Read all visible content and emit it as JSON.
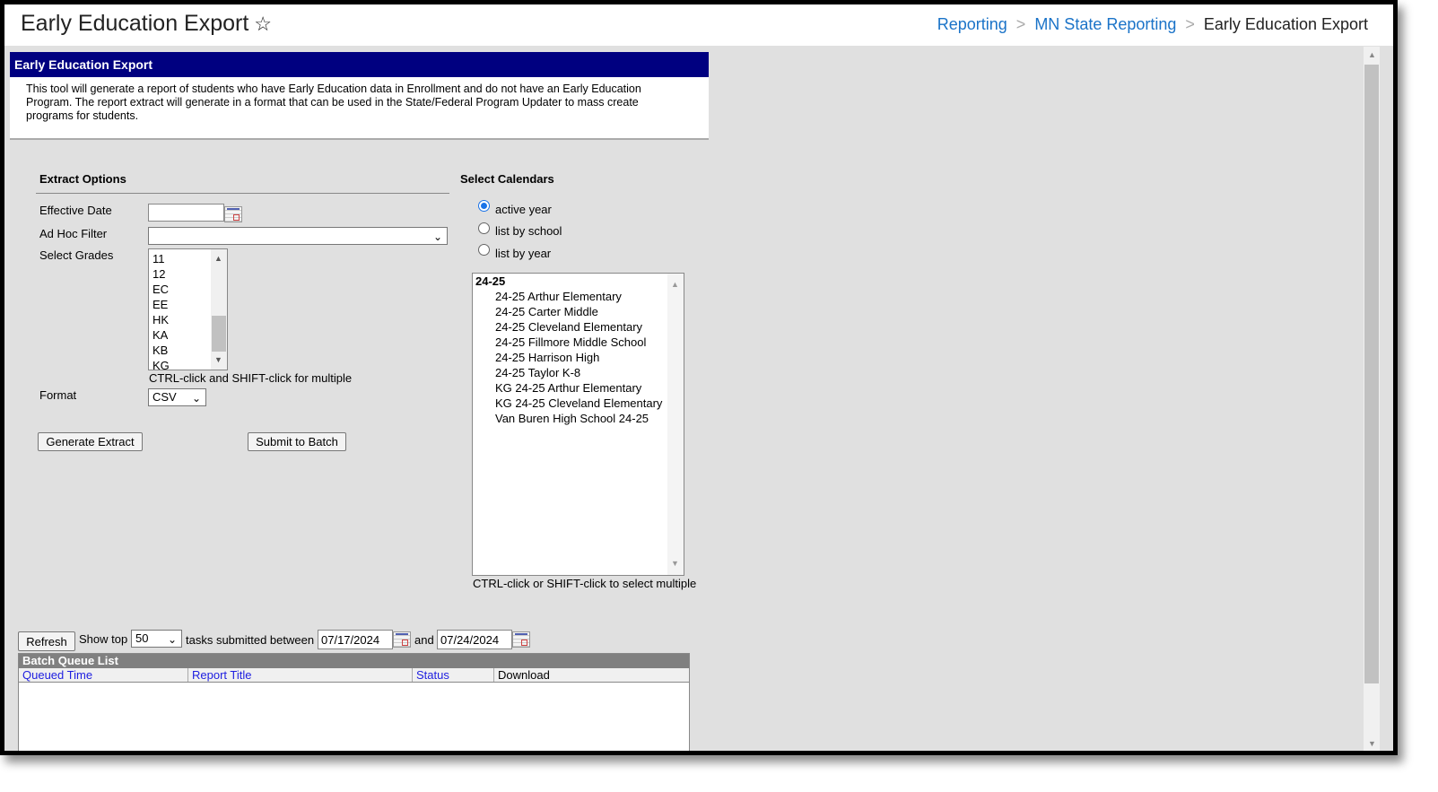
{
  "header": {
    "title": "Early Education Export",
    "favorite_icon": "star-outline-icon",
    "breadcrumb": [
      {
        "label": "Reporting"
      },
      {
        "label": "MN State Reporting"
      },
      {
        "label": "Early Education Export"
      }
    ]
  },
  "panel": {
    "title": "Early Education Export",
    "description": "This tool will generate a report of students who have Early Education data in Enrollment and do not have an Early Education Program. The report extract will generate in a format that can be used in the State/Federal Program Updater to mass create programs for students."
  },
  "extract": {
    "heading": "Extract Options",
    "effective_date_label": "Effective Date",
    "effective_date": "",
    "adhoc_label": "Ad Hoc Filter",
    "adhoc_value": "",
    "grades_label": "Select Grades",
    "grades": [
      "11",
      "12",
      "EC",
      "EE",
      "HK",
      "KA",
      "KB",
      "KG"
    ],
    "grades_hint": "CTRL-click and SHIFT-click for multiple",
    "format_label": "Format",
    "format_value": "CSV",
    "generate_label": "Generate Extract",
    "batch_label": "Submit to Batch"
  },
  "calendars": {
    "heading": "Select Calendars",
    "radios": [
      {
        "label": "active year",
        "checked": true
      },
      {
        "label": "list by school",
        "checked": false
      },
      {
        "label": "list by year",
        "checked": false
      }
    ],
    "group": "24-25",
    "items": [
      "24-25 Arthur Elementary",
      "24-25 Carter Middle",
      "24-25 Cleveland Elementary",
      "24-25 Fillmore Middle School",
      "24-25 Harrison High",
      "24-25 Taylor K-8",
      "KG 24-25 Arthur Elementary",
      "KG 24-25 Cleveland Elementary",
      "Van Buren High School 24-25"
    ],
    "hint": "CTRL-click or SHIFT-click to select multiple"
  },
  "batch": {
    "refresh_label": "Refresh",
    "show_top_label": "Show top",
    "show_top_value": "50",
    "between_label": "tasks submitted between",
    "start_date": "07/17/2024",
    "and_label": "and",
    "end_date": "07/24/2024",
    "list_title": "Batch Queue List",
    "columns": [
      "Queued Time",
      "Report Title",
      "Status",
      "Download"
    ]
  },
  "colors": {
    "panel_title_bg": "#000080",
    "link": "#1a73c8",
    "column_link": "#2020e0"
  }
}
